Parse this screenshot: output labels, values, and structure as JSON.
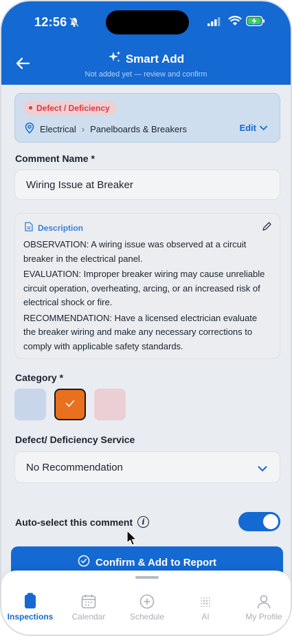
{
  "status": {
    "time": "12:56"
  },
  "header": {
    "title": "Smart Add",
    "subtitle": "Not added yet — review and confirm"
  },
  "defect": {
    "badge": "Defect / Deficiency",
    "section": "Electrical",
    "subsection": "Panelboards & Breakers",
    "edit_label": "Edit"
  },
  "comment": {
    "label": "Comment Name *",
    "value": "Wiring Issue at Breaker"
  },
  "description": {
    "label": "Description",
    "observation": "OBSERVATION: A wiring issue was observed at a circuit breaker in the electrical panel.",
    "evaluation": "EVALUATION: Improper breaker wiring may cause unreliable circuit operation, overheating, arcing, or an increased risk of electrical shock or fire.",
    "recommendation": "RECOMMENDATION: Have a licensed electrician evaluate the breaker wiring and make any necessary corrections to comply with applicable safety standards."
  },
  "category": {
    "label": "Category *",
    "swatch_colors": [
      "#c7d6ea",
      "#e8701f",
      "#ebcfd4"
    ],
    "selected_index": 1
  },
  "service": {
    "label": "Defect/ Deficiency Service",
    "value": "No Recommendation"
  },
  "auto_select": {
    "label": "Auto-select this comment",
    "enabled": true
  },
  "confirm_label": "Confirm & Add to Report",
  "tabs": [
    {
      "label": "Inspections",
      "icon": "clipboard-icon",
      "active": true
    },
    {
      "label": "Calendar",
      "icon": "calendar-icon",
      "active": false
    },
    {
      "label": "Schedule",
      "icon": "plus-circle-icon",
      "active": false
    },
    {
      "label": "AI",
      "icon": "sparkle-grid-icon",
      "active": false
    },
    {
      "label": "My Profile",
      "icon": "person-icon",
      "active": false
    }
  ],
  "colors": {
    "primary": "#1469d2",
    "defect_red": "#d93b45",
    "selected_category": "#e8701f"
  }
}
